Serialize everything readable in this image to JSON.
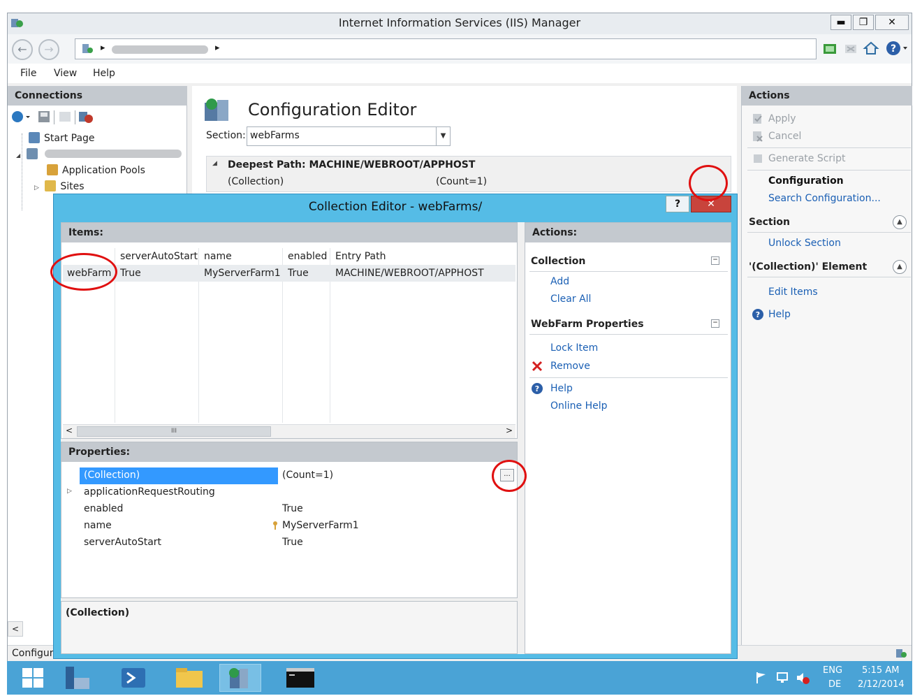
{
  "window": {
    "title": "Internet Information Services (IIS) Manager",
    "minimize": "▬",
    "maximize": "❐",
    "close": "✕"
  },
  "nav": {
    "back": "←",
    "forward": "→",
    "address_sep": "▸"
  },
  "menu": [
    "File",
    "View",
    "Help"
  ],
  "connections": {
    "header": "Connections",
    "tree": [
      {
        "label": "Start Page"
      },
      {
        "label": "Application Pools"
      },
      {
        "label": "Sites"
      }
    ],
    "expander_open": "◢",
    "expander_closed": "▷"
  },
  "config_editor": {
    "title": "Configuration Editor",
    "section_label": "Section:",
    "section_value": "webFarms",
    "deepest_path": "Deepest Path: MACHINE/WEBROOT/APPHOST",
    "collection_label": "(Collection)",
    "collection_value": "(Count=1)"
  },
  "actions": {
    "header": "Actions",
    "apply": "Apply",
    "cancel": "Cancel",
    "generate_script": "Generate Script",
    "configuration": "Configuration",
    "search_configuration": "Search Configuration...",
    "section_group": "Section",
    "unlock_section": "Unlock Section",
    "element_group": "'(Collection)' Element",
    "edit_items": "Edit Items",
    "help": "Help"
  },
  "statusbar": {
    "text": "Configur"
  },
  "dialog": {
    "title": "Collection Editor - webFarms/",
    "help_btn": "?",
    "close_btn": "✕",
    "items_header": "Items:",
    "columns": [
      "serverAutoStart",
      "name",
      "enabled",
      "Entry Path"
    ],
    "rows": [
      {
        "type": "webFarm",
        "serverAutoStart": "True",
        "name": "MyServerFarm1",
        "enabled": "True",
        "entry_path": "MACHINE/WEBROOT/APPHOST"
      }
    ],
    "scroll_left": "<",
    "scroll_right": ">",
    "scroll_thumb": "III",
    "properties_header": "Properties:",
    "properties": [
      {
        "name": "(Collection)",
        "value": "(Count=1)"
      },
      {
        "name": "applicationRequestRouting",
        "value": ""
      },
      {
        "name": "enabled",
        "value": "True"
      },
      {
        "name": "name",
        "value": "MyServerFarm1"
      },
      {
        "name": "serverAutoStart",
        "value": "True"
      }
    ],
    "ellipsis_btn": "...",
    "description": "(Collection)",
    "actions": {
      "header": "Actions:",
      "collection_group": "Collection",
      "add": "Add",
      "clear_all": "Clear All",
      "properties_group": "WebFarm Properties",
      "lock_item": "Lock Item",
      "remove": "Remove",
      "help": "Help",
      "online_help": "Online Help"
    }
  },
  "taskbar": {
    "lang": "ENG",
    "layout": "DE",
    "time": "5:15 AM",
    "date": "2/12/2014"
  },
  "colors": {
    "link": "#1a5fb4",
    "selection": "#3399ff",
    "dialog_frame": "#55bce6",
    "taskbar": "#4aa3d6",
    "highlight_circle": "#e01010"
  }
}
